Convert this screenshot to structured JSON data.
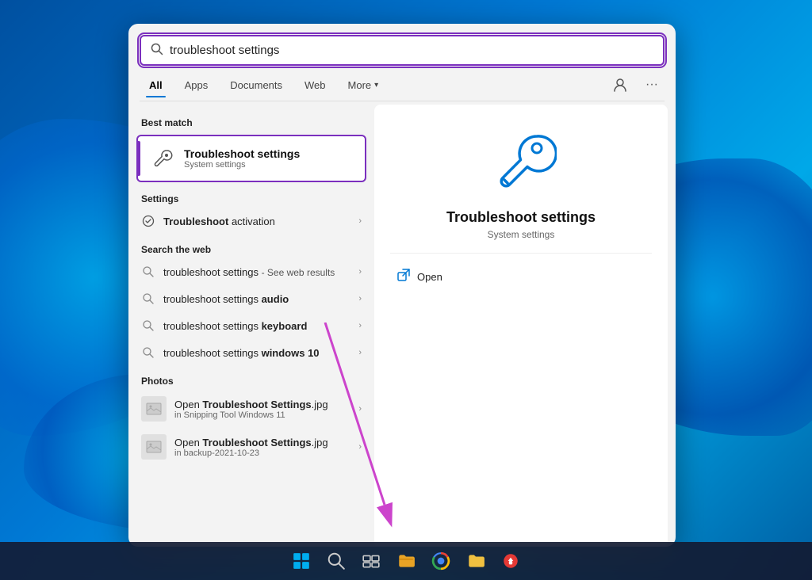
{
  "desktop": {
    "bg_color": "#0078d4"
  },
  "search_panel": {
    "search_input": {
      "placeholder": "troubleshoot settings",
      "value": "troubleshoot settings"
    },
    "tabs": [
      {
        "label": "All",
        "active": true
      },
      {
        "label": "Apps",
        "active": false
      },
      {
        "label": "Documents",
        "active": false
      },
      {
        "label": "Web",
        "active": false
      },
      {
        "label": "More",
        "has_chevron": true,
        "active": false
      }
    ],
    "best_match": {
      "section_label": "Best match",
      "title": "Troubleshoot settings",
      "subtitle": "System settings",
      "icon_type": "wrench"
    },
    "settings_section": {
      "label": "Settings",
      "items": [
        {
          "icon": "circle-check",
          "text": "Troubleshoot activation",
          "bold_part": "",
          "has_chevron": true
        }
      ]
    },
    "web_section": {
      "label": "Search the web",
      "items": [
        {
          "icon": "search",
          "text": "troubleshoot settings",
          "suffix": "- See web results",
          "bold_suffix": false,
          "has_chevron": true
        },
        {
          "icon": "search",
          "text": "troubleshoot settings ",
          "bold_part": "audio",
          "has_chevron": true
        },
        {
          "icon": "search",
          "text": "troubleshoot settings ",
          "bold_part": "keyboard",
          "has_chevron": true
        },
        {
          "icon": "search",
          "text": "troubleshoot settings ",
          "bold_part": "windows 10",
          "has_chevron": true
        }
      ]
    },
    "photos_section": {
      "label": "Photos",
      "items": [
        {
          "icon": "photo",
          "text": "Open Troubleshoot Settings.jpg",
          "sub": "in Snipping Tool Windows 11",
          "bold_part": "Troubleshoot Settings",
          "has_chevron": true
        },
        {
          "icon": "photo",
          "text": "Open Troubleshoot Settings.jpg",
          "sub": "in backup-2021-10-23",
          "bold_part": "Troubleshoot Settings",
          "has_chevron": true
        }
      ]
    }
  },
  "detail_panel": {
    "title": "Troubleshoot settings",
    "subtitle": "System settings",
    "open_label": "Open"
  },
  "taskbar": {
    "items": [
      {
        "name": "windows-start",
        "label": "Start"
      },
      {
        "name": "search",
        "label": "Search"
      },
      {
        "name": "task-view",
        "label": "Task View"
      },
      {
        "name": "file-explorer",
        "label": "File Explorer"
      },
      {
        "name": "chrome",
        "label": "Google Chrome"
      },
      {
        "name": "file-manager",
        "label": "File Manager"
      },
      {
        "name": "cast",
        "label": "Cast"
      }
    ]
  }
}
